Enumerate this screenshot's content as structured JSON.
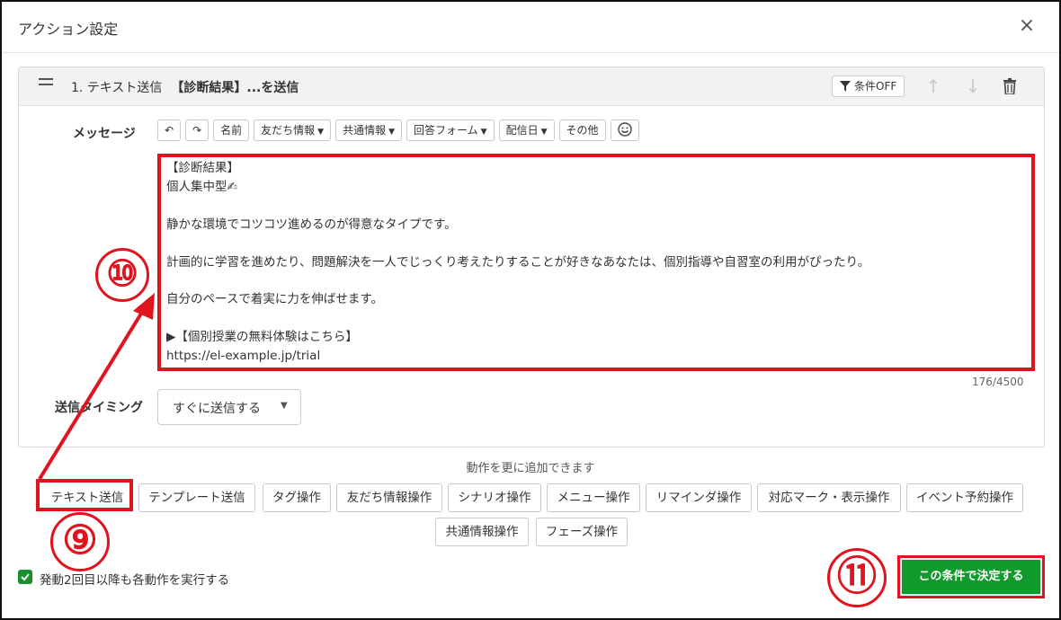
{
  "dialog": {
    "title": "アクション設定",
    "close_icon": "×"
  },
  "card": {
    "number_and_type": "1. テキスト送信",
    "subject": "【診断結果】...を送信",
    "condition_button": "条件OFF"
  },
  "labels": {
    "message": "メッセージ",
    "timing": "送信タイミング"
  },
  "toolbar": {
    "undo": "↶",
    "redo": "↷",
    "name": "名前",
    "friend_info": "友だち情報",
    "common_info": "共通情報",
    "answer_form": "回答フォーム",
    "delivery_date": "配信日",
    "other": "その他"
  },
  "message": {
    "text": "【診断結果】\n個人集中型✍\n\n静かな環境でコツコツ進めるのが得意なタイプです。\n\n計画的に学習を進めたり、問題解決を一人でじっくり考えたりすることが好きなあなたは、個別指導や自習室の利用がぴったり。\n\n自分のペースで着実に力を伸ばせます。\n\n▶【個別授業の無料体験はこちら】\nhttps://el-example.jp/trial",
    "counter": "176/4500"
  },
  "timing": {
    "value": "すぐに送信する"
  },
  "add_actions": {
    "caption": "動作を更に追加できます",
    "buttons": [
      "テキスト送信",
      "テンプレート送信",
      "タグ操作",
      "友だち情報操作",
      "シナリオ操作",
      "メニュー操作",
      "リマインダ操作",
      "対応マーク・表示操作",
      "イベント予約操作",
      "共通情報操作",
      "フェーズ操作"
    ]
  },
  "repeat_checkbox": {
    "label": "発動2回目以降も各動作を実行する",
    "checked": true
  },
  "confirm_button": "この条件で決定する",
  "annotations": [
    "⑨",
    "⑩",
    "⑪"
  ],
  "colors": {
    "accent_green": "#0f9a2b",
    "annotation_red": "#e0141e"
  }
}
